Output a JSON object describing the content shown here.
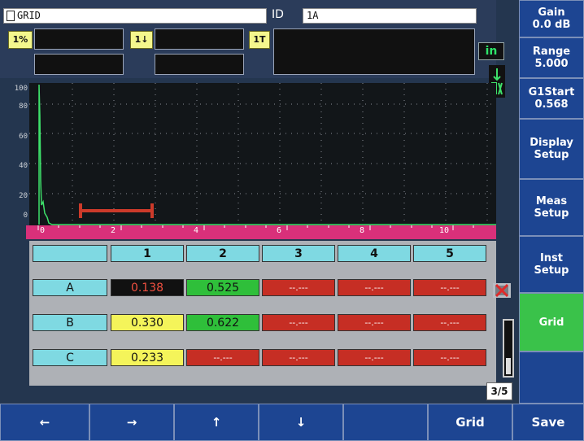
{
  "header": {
    "file_name": "GRID",
    "id_label": "ID",
    "id_value": "1A"
  },
  "readings": {
    "tag1": "1%",
    "tag2": "1↓",
    "tag3": "1T"
  },
  "unit": "in",
  "ascan": {
    "y_ticks": [
      "100",
      "80",
      "60",
      "40",
      "20",
      "0"
    ],
    "x_ticks": [
      "0",
      "2",
      "4",
      "6",
      "8",
      "10"
    ]
  },
  "grid": {
    "columns": [
      "1",
      "2",
      "3",
      "4",
      "5"
    ],
    "rows": [
      {
        "label": "A",
        "cells": [
          "0.138",
          "0.525",
          "--.---",
          "--.---",
          "--.---"
        ],
        "styles": [
          "black",
          "green",
          "red",
          "red",
          "red"
        ]
      },
      {
        "label": "B",
        "cells": [
          "0.330",
          "0.622",
          "--.---",
          "--.---",
          "--.---"
        ],
        "styles": [
          "yellow",
          "green",
          "red",
          "red",
          "red"
        ]
      },
      {
        "label": "C",
        "cells": [
          "0.233",
          "--.---",
          "--.---",
          "--.---",
          "--.---"
        ],
        "styles": [
          "yellow",
          "red",
          "red",
          "red",
          "red"
        ]
      }
    ]
  },
  "page_indicator": "3/5",
  "right_menu": [
    {
      "line1": "Gain",
      "line2": "0.0 dB"
    },
    {
      "line1": "Range",
      "line2": "5.000"
    },
    {
      "line1": "G1Start",
      "line2": "0.568"
    },
    {
      "line1": "Display",
      "line2": "Setup"
    },
    {
      "line1": "Meas",
      "line2": "Setup"
    },
    {
      "line1": "Inst",
      "line2": "Setup"
    },
    {
      "line1": "Grid",
      "line2": ""
    },
    {
      "line1": "",
      "line2": ""
    }
  ],
  "bottom_bar": [
    "←",
    "→",
    "↑",
    "↓",
    "",
    "Grid",
    "Save"
  ]
}
